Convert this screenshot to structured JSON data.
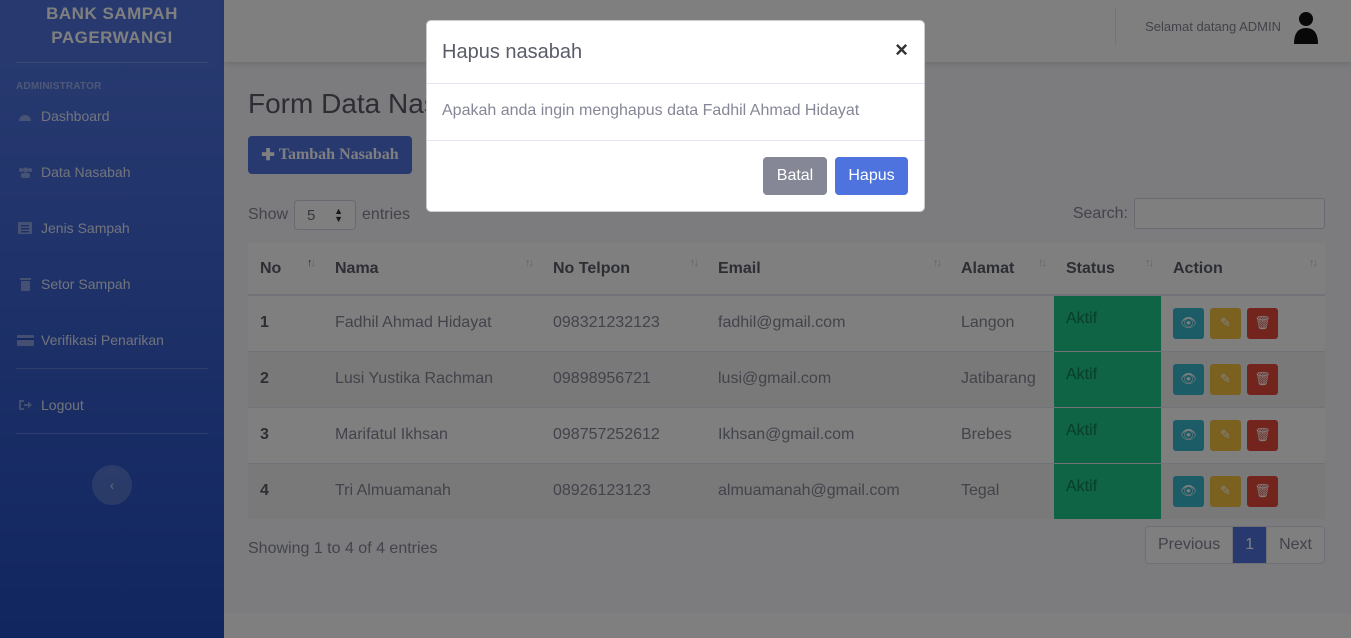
{
  "sidebar": {
    "brand_line1": "BANK SAMPAH",
    "brand_line2": "PAGERWANGI",
    "heading": "ADMINISTRATOR",
    "items": [
      {
        "label": "Dashboard",
        "icon": "tachometer-icon"
      },
      {
        "label": "Data Nasabah",
        "icon": "users-icon"
      },
      {
        "label": "Jenis Sampah",
        "icon": "list-icon"
      },
      {
        "label": "Setor Sampah",
        "icon": "trash-icon"
      },
      {
        "label": "Verifikasi Penarikan",
        "icon": "money-icon"
      }
    ],
    "logout_label": "Logout",
    "toggle_icon": "chevron-left-icon"
  },
  "topbar": {
    "greeting": "Selamat datang ADMIN"
  },
  "main": {
    "page_title": "Form Data Nasabah",
    "add_button_label": "Tambah Nasabah",
    "show_label": "Show",
    "entries_label": "entries",
    "page_size": "5",
    "search_label": "Search:",
    "columns": [
      "No",
      "Nama",
      "No Telpon",
      "Email",
      "Alamat",
      "Status",
      "Action"
    ],
    "rows": [
      {
        "no": "1",
        "nama": "Fadhil Ahmad Hidayat",
        "telpon": "098321232123",
        "email": "fadhil@gmail.com",
        "alamat": "Langon",
        "status": "Aktif"
      },
      {
        "no": "2",
        "nama": "Lusi Yustika Rachman",
        "telpon": "09898956721",
        "email": "lusi@gmail.com",
        "alamat": "Jatibarang",
        "status": "Aktif"
      },
      {
        "no": "3",
        "nama": "Marifatul Ikhsan",
        "telpon": "098757252612",
        "email": "Ikhsan@gmail.com",
        "alamat": "Brebes",
        "status": "Aktif"
      },
      {
        "no": "4",
        "nama": "Tri Almuamanah",
        "telpon": "08926123123",
        "email": "almuamanah@gmail.com",
        "alamat": "Tegal",
        "status": "Aktif"
      }
    ],
    "info": "Showing 1 to 4 of 4 entries",
    "pagination": {
      "previous": "Previous",
      "current": "1",
      "next": "Next"
    }
  },
  "modal": {
    "title": "Hapus nasabah",
    "close": "×",
    "message": "Apakah anda ingin menghapus data Fadhil Ahmad Hidayat",
    "cancel_label": "Batal",
    "confirm_label": "Hapus"
  },
  "colors": {
    "primary": "#4e73df",
    "success": "#1cc88a",
    "info": "#36b9cc",
    "warning": "#f6c23e",
    "danger": "#e74a3b",
    "secondary": "#858796"
  }
}
